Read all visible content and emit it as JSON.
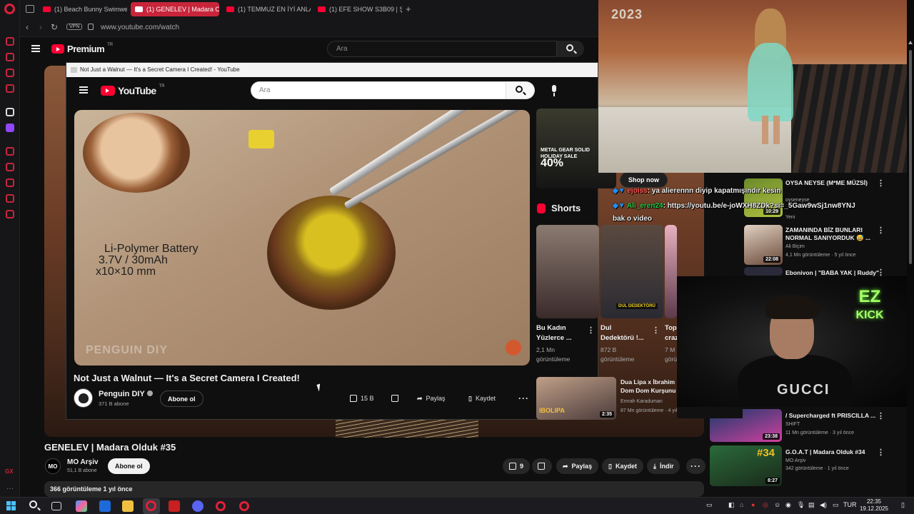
{
  "browser": {
    "tabs": [
      {
        "label": "(1) Beach Bunny Swimwe",
        "active": false
      },
      {
        "label": "(1) GENELEV | Madara Ol",
        "active": true
      },
      {
        "label": "(1) TEMMUZ EN İYİ ANLA",
        "active": false
      },
      {
        "label": "(1) EFE SHOW S3B09 | ŞA",
        "active": false
      }
    ],
    "vpn_badge": "VPN",
    "url": "www.youtube.com/watch"
  },
  "background_page": {
    "logo": "Premium",
    "logo_country": "TR",
    "search_placeholder": "Ara",
    "video_title": "GENELEV | Madara Olduk #35",
    "channel_initials": "MO",
    "channel_name": "MO Arşiv",
    "channel_subs": "51,1 B abone",
    "subscribe_label": "Abone ol",
    "likes": "9",
    "share_label": "Paylaş",
    "save_label": "Kaydet",
    "download_label": "İndir",
    "views_line": "366 görüntüleme  1 yıl önce"
  },
  "pip_window": {
    "window_title": "Not Just a Walnut — It's a Secret Camera I Created! - YouTube",
    "logo": "YouTube",
    "logo_country": "TR",
    "search_placeholder": "Ara",
    "video": {
      "overlay_line1": "Li-Polymer Battery",
      "overlay_line2": "3.7V / 30mAh",
      "overlay_line3": "x10×10 mm",
      "watermark": "PENGUIN DIY"
    },
    "video_title": "Not Just a Walnut — It's a Secret Camera I Created!",
    "channel_name": "Penguin DIY",
    "channel_subs": "371 B abone",
    "subscribe_label": "Abone ol",
    "likes": "15 B",
    "share_label": "Paylaş",
    "save_label": "Kaydet"
  },
  "sidebar": {
    "ad": {
      "line1": "METAL GEAR SOLID",
      "line2": "HOLIDAY SALE",
      "percent": "40%",
      "cta": "Shop now"
    },
    "shorts_heading": "Shorts",
    "shorts": [
      {
        "title1": "Bu Kadın",
        "title2": "Yüzlerce ...",
        "views1": "2,1 Mn",
        "views2": "görüntüleme"
      },
      {
        "title1": "Dul",
        "title2": "Dedektörü !...",
        "views1": "872 B",
        "views2": "görüntüleme",
        "badge": "DUL DEDEKTÖRÜ"
      },
      {
        "title1": "Top",
        "title2": "craz",
        "views1": "7 M",
        "views2": "görü"
      }
    ],
    "bottom_video": {
      "title1": "Dua Lipa x İbrahim",
      "title2": "Dom Dom Kurşunu",
      "channel": "Emrah Karaduman",
      "meta": "87 Mn görüntüleme · 4 yıl önce",
      "duration": "2:35",
      "thumb_text": "IBOLIPA"
    }
  },
  "recommendations": [
    {
      "title1": "OYSA NEYSE (M*ME MÜZSİ)",
      "title2": "",
      "channel": "oyseneyse",
      "meta": "Yeni",
      "duration": "10:29"
    },
    {
      "title1": "ZAMANINDA BİZ BUNLARI",
      "title2": "NORMAL SANIYORDUK 😅 ...",
      "channel": "Ali Biçim",
      "meta": "4,1 Mn görüntüleme · 5 yıl önce",
      "duration": "22:08"
    },
    {
      "title1": "Ebonivon | \"BABA YAK | Ruddy\"",
      "title2": "",
      "channel": "",
      "meta": "",
      "duration": ""
    },
    {
      "title1": "/ Supercharged ft PRISCILLA ...",
      "title2": "",
      "channel": "SHIFT",
      "meta": "11 Mn görüntüleme · 3 yıl önce",
      "duration": "23:38"
    },
    {
      "title1": "G.O.A.T | Madara Olduk #34",
      "title2": "",
      "channel": "MO Arşiv",
      "meta": "342 görüntüleme · 1 yıl önce",
      "duration": "8:27",
      "thumb_text": "#34"
    }
  ],
  "chat": [
    {
      "user": "ejoiss",
      "message": ": ya alierennn diyip kapatmışındır kesin"
    },
    {
      "user": "Ali_eren24",
      "message": ": https://youtu.be/e-joWXH8ZDk?si=_5Gaw9wSj1nw8YNJ"
    },
    {
      "user": "",
      "message": "bak o video"
    }
  ],
  "runway": {
    "year_text": "2023"
  },
  "webcam": {
    "ez": "EZ",
    "kick": "KICK",
    "shirt": "GUCCI"
  },
  "taskbar": {
    "language": "TUR",
    "time": "22:35",
    "date": "19.12.2025"
  },
  "colors": {
    "youtube_red": "#ff0033",
    "opera_red": "#c8253b",
    "background": "#0f0f0f",
    "kick_green": "#a6ff6a"
  }
}
